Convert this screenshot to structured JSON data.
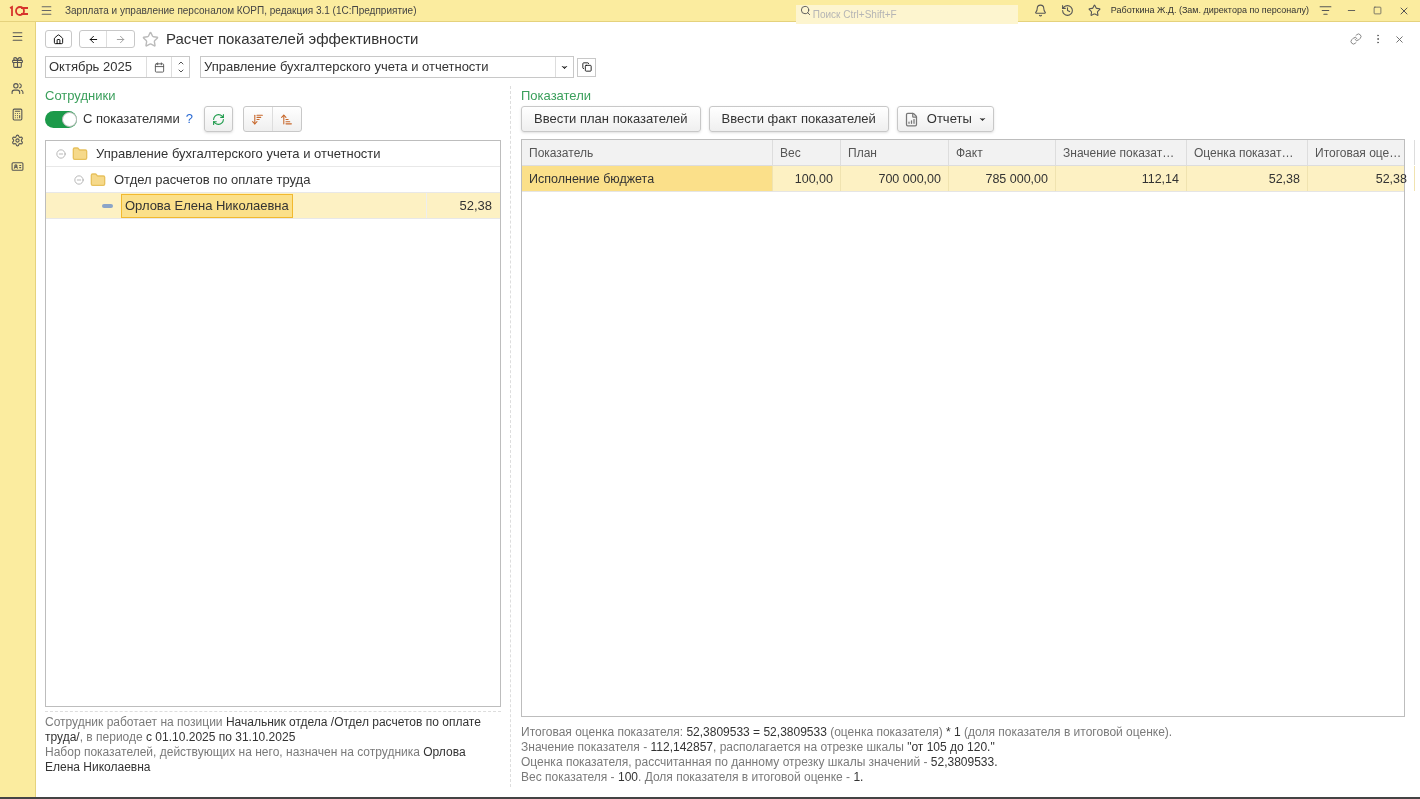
{
  "app": {
    "title": "Зарплата и управление персоналом КОРП, редакция 3.1  (1С:Предприятие)",
    "search_placeholder": "Поиск Ctrl+Shift+F",
    "user": "Работкина Ж.Д. (Зам. директора по персоналу)"
  },
  "form": {
    "title": "Расчет показателей эффективности",
    "period": "Октябрь 2025",
    "department": "Управление бухгалтерского учета и отчетности"
  },
  "employees": {
    "heading": "Сотрудники",
    "toggle": {
      "label": "С показателями",
      "on": true
    },
    "help": "?",
    "tree": [
      {
        "kind": "folder",
        "label": "Управление бухгалтерского учета и отчетности",
        "expanded": true,
        "selected": false,
        "children": [
          {
            "kind": "folder",
            "label": "Отдел расчетов по оплате труда",
            "expanded": true,
            "selected": false,
            "children": [
              {
                "kind": "employee",
                "label": "Орлова Елена Николаевна",
                "value": "52,38",
                "selected": true
              }
            ]
          }
        ]
      }
    ],
    "info": [
      [
        {
          "t": "Сотрудник работает на позиции ",
          "dark": false
        },
        {
          "t": "Начальник отдела /Отдел расчетов по оплате труда/",
          "dark": true
        },
        {
          "t": ", в периоде ",
          "dark": false
        },
        {
          "t": "с 01.10.2025 по 31.10.2025",
          "dark": true
        }
      ],
      [
        {
          "t": "Набор показателей, действующих на него, назначен на сотрудника ",
          "dark": false
        },
        {
          "t": "Орлова Елена Николаевна",
          "dark": true
        }
      ]
    ]
  },
  "indicators": {
    "heading": "Показатели",
    "buttons": [
      "Ввести план показателей",
      "Ввести факт показателей"
    ],
    "reports_button": "Отчеты",
    "columns": [
      "Показатель",
      "Вес",
      "План",
      "Факт",
      "Значение показат…",
      "Оценка показат…",
      "Итоговая оце…"
    ],
    "rows": [
      {
        "cells": [
          "Исполнение бюджета",
          "100,00",
          "700 000,00",
          "785 000,00",
          "112,14",
          "52,38",
          "52,38"
        ],
        "selected": true
      }
    ],
    "info": [
      [
        {
          "t": "Итоговая оценка показателя: ",
          "dark": false
        },
        {
          "t": "52,3809533 = 52,3809533",
          "dark": true
        },
        {
          "t": " (оценка показателя) ",
          "dark": false
        },
        {
          "t": "* 1",
          "dark": true
        },
        {
          "t": " (доля показателя в итоговой оценке).",
          "dark": false
        }
      ],
      [
        {
          "t": "Значение показателя - ",
          "dark": false
        },
        {
          "t": "112,142857",
          "dark": true
        },
        {
          "t": ", располагается на отрезке шкалы ",
          "dark": false
        },
        {
          "t": "\"от 105 до 120.\"",
          "dark": true
        }
      ],
      [
        {
          "t": "Оценка показателя, рассчитанная по данному отрезку шкалы значений - ",
          "dark": false
        },
        {
          "t": "52,3809533.",
          "dark": true
        }
      ],
      [
        {
          "t": "Вес показателя - ",
          "dark": false
        },
        {
          "t": "100",
          "dark": true
        },
        {
          "t": ". Доля показателя в итоговой оценке - ",
          "dark": false
        },
        {
          "t": "1.",
          "dark": true
        }
      ]
    ]
  }
}
